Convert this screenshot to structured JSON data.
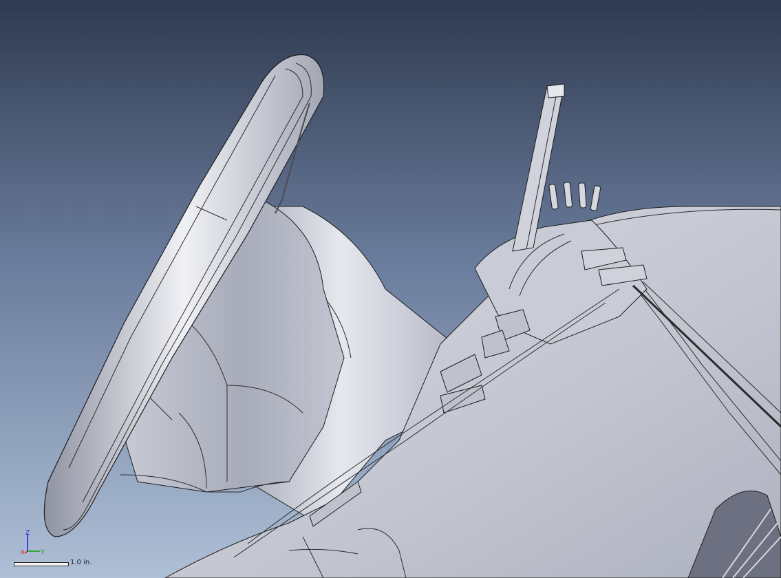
{
  "viewport": {
    "background_top": "#2f3a50",
    "background_bottom": "#a9bbd2",
    "model_color": "#c4c7d2",
    "edge_color": "#1c1c1c"
  },
  "triad": {
    "z_label": "Z",
    "y_label": "Y",
    "x_label": "X",
    "z_color": "#1a1aff",
    "y_color": "#10a010",
    "x_color": "#e01010"
  },
  "scale_bar": {
    "label": "1.0 in."
  }
}
